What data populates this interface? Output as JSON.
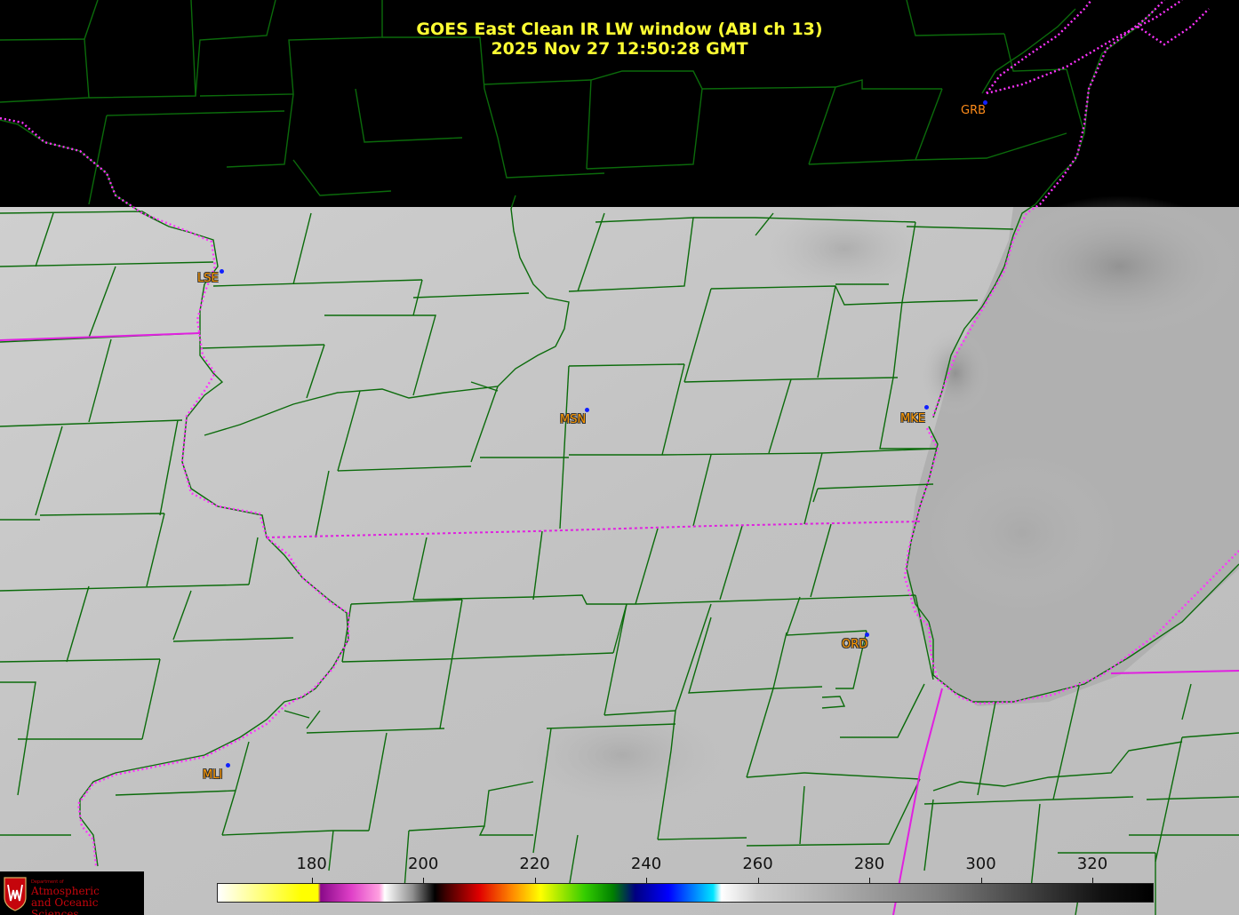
{
  "title": {
    "line1": "GOES East Clean IR LW window (ABI ch 13)",
    "line2": "2025 Nov 27  12:50:28 GMT"
  },
  "stations": [
    {
      "id": "grb",
      "label": "GRB"
    },
    {
      "id": "lse",
      "label": "LSE"
    },
    {
      "id": "msn",
      "label": "MSN"
    },
    {
      "id": "mke",
      "label": "MKE"
    },
    {
      "id": "ord",
      "label": "ORD"
    },
    {
      "id": "mli",
      "label": "MLI"
    }
  ],
  "colorbar": {
    "unit_range": [
      163,
      331
    ],
    "ticks": [
      "180",
      "200",
      "220",
      "240",
      "260",
      "280",
      "300",
      "320"
    ],
    "colors": {
      "yellow": "#ffff00",
      "magenta": "#e040c8",
      "red": "#e00000",
      "green": "#33cc00",
      "navy": "#000080",
      "cyan": "#00e5ff",
      "gray_light": "#d0d0d0",
      "gray_dark": "#101010"
    }
  },
  "map_style": {
    "county_line_color": "#0b6b0b",
    "state_line_color": "#e020e0",
    "no_data_color": "#000000",
    "cloud_field_color": "#bdbdbd"
  },
  "logo": {
    "small_text": "Department of",
    "line1": "Atmospheric",
    "line2": "and Oceanic Sciences"
  }
}
